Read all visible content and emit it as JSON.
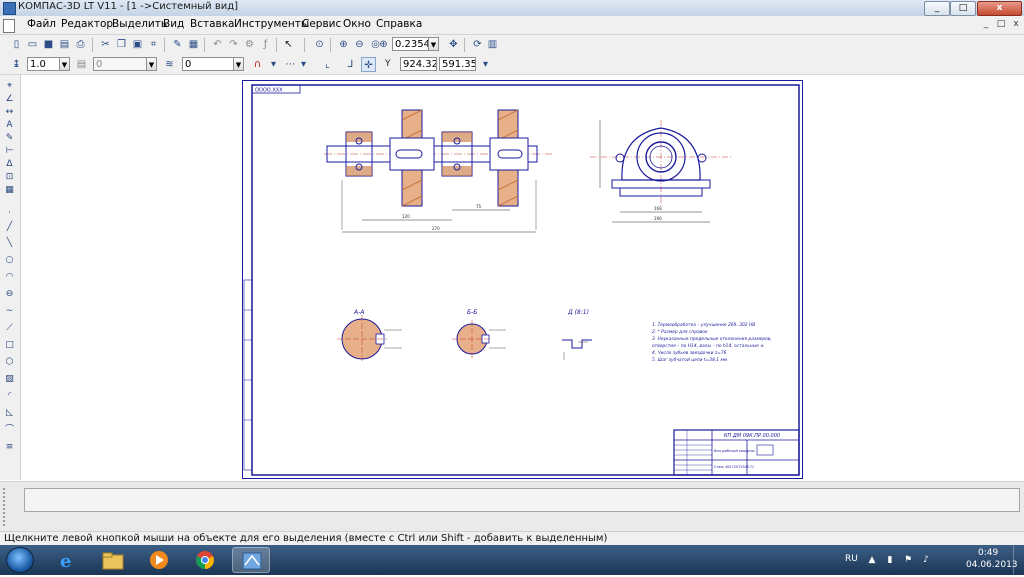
{
  "window": {
    "title": "КОМПАС-3D LT V11 - [1 ->Системный вид]",
    "min_glyph": "_",
    "max_glyph": "□",
    "close_glyph": "x"
  },
  "menubar": {
    "items": [
      "Файл",
      "Редактор",
      "Выделить",
      "Вид",
      "Вставка",
      "Инструменты",
      "Сервис",
      "Окно",
      "Справка"
    ]
  },
  "toolbar1": {
    "zoom_value": "0.2354",
    "icons": [
      "new-icon",
      "open-icon",
      "save-icon",
      "print-icon",
      "cut-icon",
      "copy-icon",
      "paste-icon",
      "format-icon",
      "undo-icon",
      "redo-icon",
      "variables-icon",
      "formula-icon",
      "help-arrow-icon",
      "zoom-icon",
      "zoom-in-icon",
      "zoom-out-icon",
      "zoom-scale-icon",
      "pan-icon",
      "refresh-icon",
      "views-icon"
    ]
  },
  "toolbar2": {
    "style_value": "1.0",
    "layer_value": "0",
    "view_value": "0",
    "x_value": "924.32",
    "y_value": "591.35",
    "xy_label": "Y",
    "icons": [
      "snap-icon",
      "grid-icon",
      "local-cs-icon",
      "ortho-icon",
      "snaps-icon",
      "coords-icon"
    ]
  },
  "lefttoolbar": {
    "icons": [
      "select-icon",
      "geometry-icon",
      "dimensions-icon",
      "symbols-icon",
      "edit-icon",
      "parameters-icon",
      "measure-icon",
      "selection-icon",
      "spec-icon",
      "point-icon",
      "line-icon",
      "segment-icon",
      "circle-icon",
      "arc-icon",
      "ellipse-icon",
      "spline-icon",
      "polyline-icon",
      "rectangle-icon",
      "polygon-icon",
      "hatch-icon",
      "fillet-icon",
      "chamfer-icon",
      "contour-icon",
      "bezier-icon",
      "equidistant-icon",
      "offset-icon",
      "trim-icon",
      "texts-icon",
      "table-icon"
    ]
  },
  "drawing": {
    "stamp_top": "ОООО.ХХХ",
    "section_aa": "А-А",
    "section_bb": "Б-Б",
    "view_d": "Д (8:1)",
    "notes": [
      "1. Термообработка – улучшение 269..302 НВ",
      "2. * Размер для справок",
      "3. Неуказанные предельные отклонения размеров,",
      "   отверстия – по Н14, валы – по h14, остальные ±",
      "4. Число зубьев звездочки z=76",
      "5. Шаг зубчатой цепи t=38,1 мм"
    ],
    "tb_designation": "КП ДМ 09К.ПР.00.000",
    "tb_name": "Вал рабочий машины",
    "tb_material": "Сталь 40Х ГОСТ4543-71",
    "dim_total": "270",
    "dim_a": "120",
    "dim_b": "75",
    "dim_w1": "160",
    "dim_w2": "190"
  },
  "statusbar": {
    "text": "Щелкните левой кнопкой мыши на объекте для его выделения (вместе с Ctrl или Shift - добавить к выделенным)"
  },
  "taskbar": {
    "lang": "RU",
    "time": "0:49",
    "date": "04.06.2013",
    "apps": [
      "ie-icon",
      "explorer-icon",
      "media-player-icon",
      "chrome-icon",
      "kompas-icon"
    ]
  },
  "colors": {
    "drawing_line": "#1a1a9c",
    "hatch": "#c8733a",
    "axis": "#c0392b",
    "dim": "#2a2a2a"
  }
}
